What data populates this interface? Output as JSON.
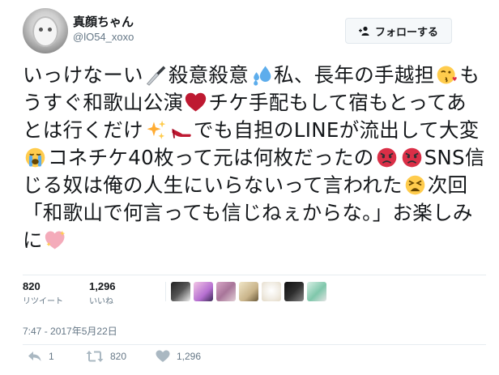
{
  "user": {
    "display_name": "真顔ちゃん",
    "screen_name": "@lO54_xoxo",
    "follow_label": "フォローする"
  },
  "tweet": {
    "segments": [
      {
        "type": "text",
        "value": "いっけなーい"
      },
      {
        "type": "emoji",
        "name": "knife-emoji"
      },
      {
        "type": "text",
        "value": "殺意殺意"
      },
      {
        "type": "emoji",
        "name": "sweat-droplets-emoji"
      },
      {
        "type": "text",
        "value": "私、長年の手越担"
      },
      {
        "type": "emoji",
        "name": "face-blowing-kiss-emoji"
      },
      {
        "type": "text",
        "value": "もうすぐ和歌山公演"
      },
      {
        "type": "emoji",
        "name": "red-heart-emoji"
      },
      {
        "type": "text",
        "value": "チケ手配もして宿もとってあとは行くだけ"
      },
      {
        "type": "emoji",
        "name": "sparkles-emoji"
      },
      {
        "type": "emoji",
        "name": "high-heel-emoji"
      },
      {
        "type": "text",
        "value": "でも自担のLINEが流出して大変"
      },
      {
        "type": "emoji",
        "name": "loudly-crying-face-emoji"
      },
      {
        "type": "text",
        "value": "コネチケ40枚って元は何枚だったの"
      },
      {
        "type": "emoji",
        "name": "pouting-face-emoji"
      },
      {
        "type": "emoji",
        "name": "pouting-face-emoji"
      },
      {
        "type": "text",
        "value": "SNS信じる奴は俺の人生にいらないって言われた"
      },
      {
        "type": "emoji",
        "name": "weary-face-emoji"
      },
      {
        "type": "text",
        "value": "次回「和歌山で何言っても信じねぇからな。」お楽しみに"
      },
      {
        "type": "emoji",
        "name": "sparkling-heart-emoji"
      }
    ]
  },
  "stats": {
    "retweets": {
      "count": "820",
      "label": "リツイート"
    },
    "likes": {
      "count": "1,296",
      "label": "いいね"
    },
    "liker_avatars": [
      "liker-avatar-1",
      "liker-avatar-2",
      "liker-avatar-3",
      "liker-avatar-4",
      "liker-avatar-5",
      "liker-avatar-6",
      "liker-avatar-7"
    ]
  },
  "timestamp": "7:47 - 2017年5月22日",
  "actions": {
    "reply_count": "1",
    "retweet_count": "820",
    "like_count": "1,296"
  },
  "colors": {
    "text": "#14171a",
    "secondary": "#657786",
    "border": "#e6ecf0",
    "button_bg": "#f5f8fa"
  }
}
